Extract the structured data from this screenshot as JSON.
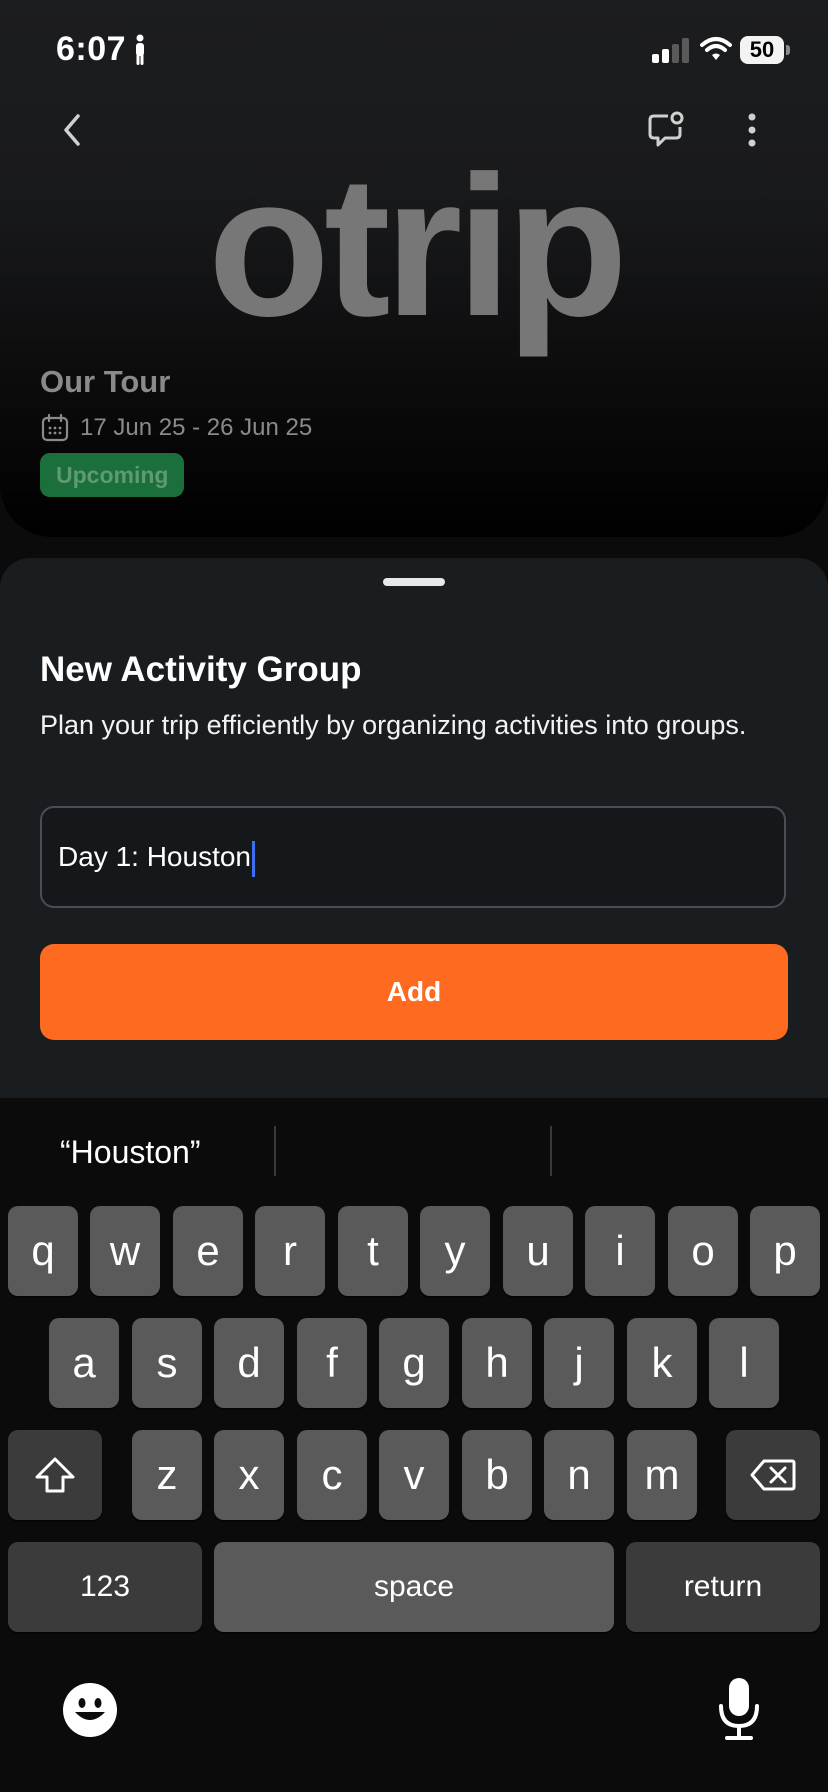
{
  "status_bar": {
    "time": "6:07",
    "battery": "50"
  },
  "header": {
    "logo_text": "otrip"
  },
  "trip": {
    "title": "Our Tour",
    "dates": "17 Jun 25 - 26 Jun 25",
    "status": "Upcoming"
  },
  "sheet": {
    "title": "New Activity Group",
    "description": "Plan your trip efficiently by organizing activities into groups.",
    "input_value": "Day 1: Houston",
    "add_label": "Add"
  },
  "keyboard": {
    "suggestions": [
      "“Houston”",
      "",
      ""
    ],
    "row1": [
      "q",
      "w",
      "e",
      "r",
      "t",
      "y",
      "u",
      "i",
      "o",
      "p"
    ],
    "row2": [
      "a",
      "s",
      "d",
      "f",
      "g",
      "h",
      "j",
      "k",
      "l"
    ],
    "row3": [
      "z",
      "x",
      "c",
      "v",
      "b",
      "n",
      "m"
    ],
    "numbers_label": "123",
    "space_label": "space",
    "return_label": "return"
  },
  "colors": {
    "accent": "#ff6a21",
    "badge_bg": "#1b6f3a",
    "sheet_bg": "#1a1d20",
    "caret": "#3c6ef0"
  }
}
